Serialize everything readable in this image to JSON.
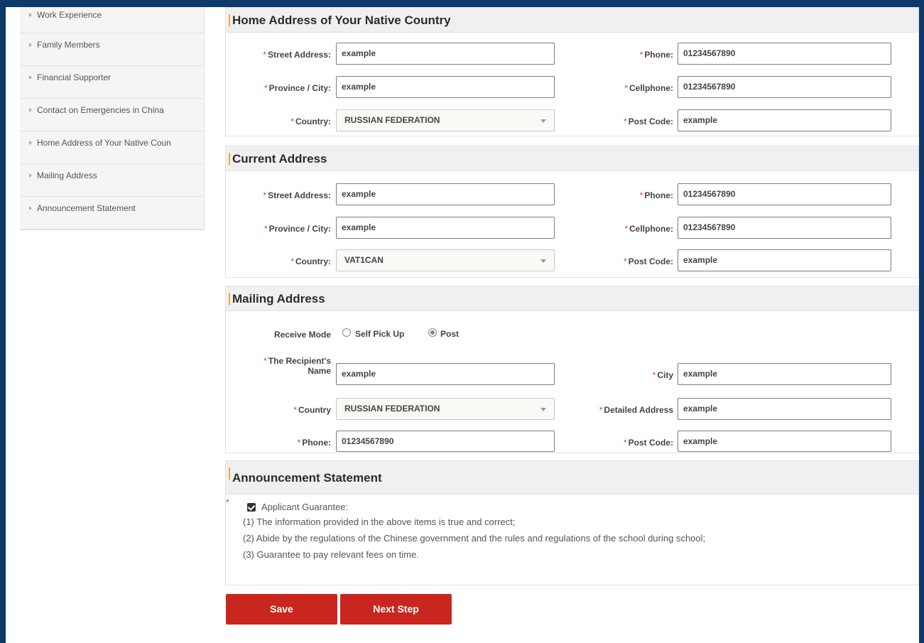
{
  "sidebar": {
    "items": [
      {
        "label": "Work Experience"
      },
      {
        "label": "Family Members"
      },
      {
        "label": "Financial Supporter"
      },
      {
        "label": "Contact on Emergencies in China"
      },
      {
        "label": "Home Address of Your Native Coun"
      },
      {
        "label": "Mailing Address"
      },
      {
        "label": "Announcement Statement"
      }
    ]
  },
  "home_address": {
    "title": "Home Address of Your Native Country",
    "street_label": "Street Address:",
    "street_value": "example",
    "province_label": "Province / City:",
    "province_value": "example",
    "country_label": "Country:",
    "country_value": "RUSSIAN FEDERATION",
    "phone_label": "Phone:",
    "phone_value": "01234567890",
    "cellphone_label": "Cellphone:",
    "cellphone_value": "01234567890",
    "postcode_label": "Post Code:",
    "postcode_value": "example"
  },
  "current_address": {
    "title": "Current Address",
    "street_label": "Street Address:",
    "street_value": "example",
    "province_label": "Province / City:",
    "province_value": "example",
    "country_label": "Country:",
    "country_value": "VAT1CAN",
    "phone_label": "Phone:",
    "phone_value": "01234567890",
    "cellphone_label": "Cellphone:",
    "cellphone_value": "01234567890",
    "postcode_label": "Post Code:",
    "postcode_value": "example"
  },
  "mailing_address": {
    "title": "Mailing Address",
    "receive_mode_label": "Receive Mode",
    "option_self_pickup": "Self Pick Up",
    "option_post": "Post",
    "selected_mode": "Post",
    "recipient_label_line1": "The Recipient's",
    "recipient_label_line2": "Name",
    "recipient_value": "example",
    "country_label": "Country",
    "country_value": "RUSSIAN FEDERATION",
    "phone_label": "Phone:",
    "phone_value": "01234567890",
    "city_label": "City",
    "city_value": "example",
    "detailed_label": "Detailed Address",
    "detailed_value": "example",
    "postcode_label": "Post Code:",
    "postcode_value": "example"
  },
  "announcement": {
    "title": "Announcement Statement",
    "guarantee_label": "Applicant Guarantee:",
    "guarantee_checked": true,
    "items": [
      "(1) The information provided in the above items is true and correct;",
      "(2) Abide by the regulations of the Chinese government and the rules and regulations of the school during school;",
      "(3) Guarantee to pay relevant fees on time."
    ]
  },
  "actions": {
    "save_label": "Save",
    "next_label": "Next Step"
  },
  "colors": {
    "frame": "#0e3a6a",
    "accent": "#f3a53a",
    "button": "#c9261f",
    "required": "#e03a2e"
  }
}
